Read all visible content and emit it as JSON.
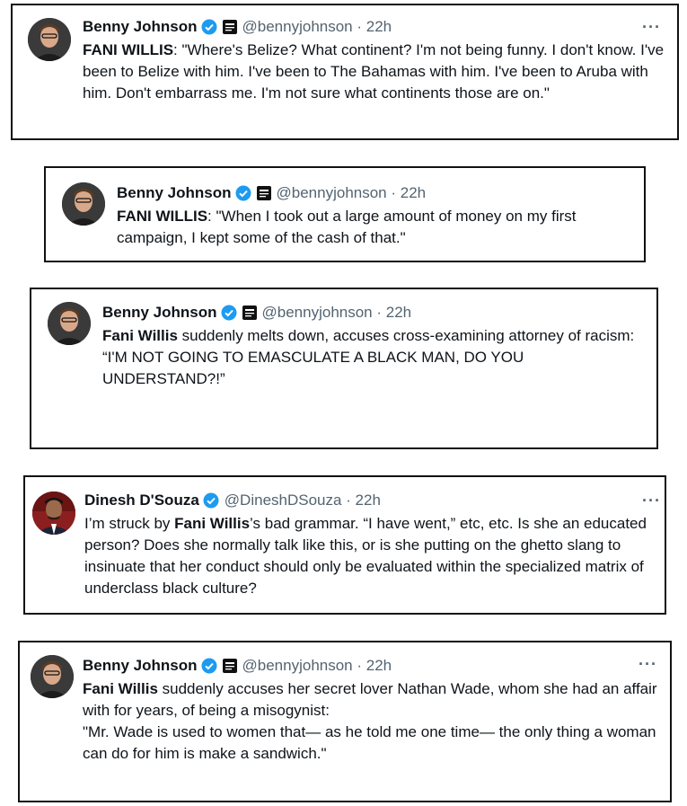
{
  "tweets": [
    {
      "author": "Benny Johnson",
      "handle": "@bennyjohnson · 22h",
      "more": "···",
      "bold": "FANI WILLIS",
      "text": ": \"Where's Belize? What continent? I'm not being funny. I don't know. I've been to Belize with him. I've been to The Bahamas with him. I've been to Aruba with him. Don't embarrass me. I'm not sure what continents those are on.\""
    },
    {
      "author": "Benny Johnson",
      "handle": "@bennyjohnson · 22h",
      "bold": "FANI WILLIS",
      "text": ": \"When I took out a large amount of money on my first campaign, I kept some of the cash of that.\""
    },
    {
      "author": "Benny Johnson",
      "handle": "@bennyjohnson · 22h",
      "bold": "Fani Willis",
      "text": " suddenly melts down, accuses cross-examining attorney of racism:",
      "text2": "“I'M NOT GOING TO EMASCULATE A BLACK MAN, DO YOU UNDERSTAND?!”"
    },
    {
      "author": "Dinesh D'Souza",
      "handle": "@DineshDSouza · 22h",
      "more": "···",
      "pre": "I’m struck by ",
      "bold": "Fani Willis",
      "text": "’s bad grammar. “I have went,” etc, etc. Is she an educated person? Does she normally talk like this, or is she putting on the ghetto slang to insinuate that her conduct should only be evaluated within the specialized matrix of underclass black culture?"
    },
    {
      "author": "Benny Johnson",
      "handle": "@bennyjohnson · 22h",
      "more": "···",
      "bold": "Fani Willis",
      "text": " suddenly accuses her secret lover Nathan Wade, whom she had an affair with for years, of being a misogynist:",
      "text2": "\"Mr. Wade is used to women that— as he told me one time— the only thing a woman can do for him is make a sandwich.\""
    }
  ],
  "colors": {
    "verified": "#1d9bf0",
    "handle": "#536471",
    "border": "#111111"
  }
}
